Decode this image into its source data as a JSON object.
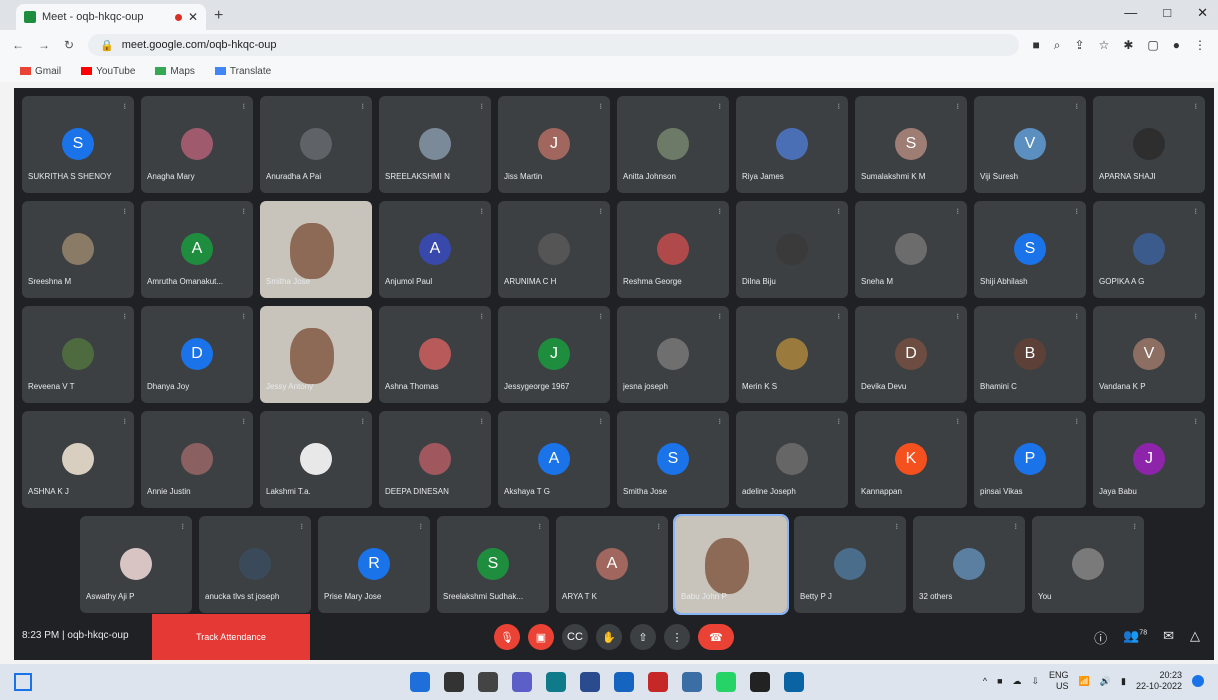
{
  "browser": {
    "tab_title": "Meet - oqb-hkqc-oup",
    "new_tab": "+",
    "url": "meet.google.com/oqb-hkqc-oup",
    "window_controls": [
      "—",
      "□",
      "✕"
    ]
  },
  "bookmarks": [
    {
      "label": "Gmail",
      "color": "#ea4335"
    },
    {
      "label": "YouTube",
      "color": "#ff0000"
    },
    {
      "label": "Maps",
      "color": "#34a853"
    },
    {
      "label": "Translate",
      "color": "#4285f4"
    }
  ],
  "participants": [
    [
      {
        "name": "SUKRITHA S SHENOY",
        "initial": "S",
        "color": "#1a73e8"
      },
      {
        "name": "Anagha Mary",
        "initial": "",
        "color": "#a05a6e"
      },
      {
        "name": "Anuradha A Pai",
        "initial": "",
        "color": "#5f6368"
      },
      {
        "name": "SREELAKSHMI N",
        "initial": "",
        "color": "#7b8a99"
      },
      {
        "name": "Jiss Martin",
        "initial": "J",
        "color": "#a1665e"
      },
      {
        "name": "Anitta Johnson",
        "initial": "",
        "color": "#6d7a68"
      },
      {
        "name": "Riya James",
        "initial": "",
        "color": "#4a6fb5"
      },
      {
        "name": "Sumalakshmi K M",
        "initial": "S",
        "color": "#9e7d74"
      },
      {
        "name": "Viji Suresh",
        "initial": "V",
        "color": "#5a8fc0"
      },
      {
        "name": "APARNA SHAJI",
        "initial": "",
        "color": "#2e2e2e"
      }
    ],
    [
      {
        "name": "Sreeshna M",
        "initial": "",
        "color": "#8a7b66"
      },
      {
        "name": "Amrutha Omanakut...",
        "initial": "A",
        "color": "#1e8e3e"
      },
      {
        "name": "Smitha Jose",
        "initial": "",
        "color": "#c7a08a",
        "video": true
      },
      {
        "name": "Anjumol Paul",
        "initial": "A",
        "color": "#3949ab"
      },
      {
        "name": "ARUNIMA C H",
        "initial": "",
        "color": "#555"
      },
      {
        "name": "Reshma George",
        "initial": "",
        "color": "#b04a4a"
      },
      {
        "name": "Dilna Biju",
        "initial": "",
        "color": "#3a3a3a"
      },
      {
        "name": "Sneha M",
        "initial": "",
        "color": "#6c6c6c"
      },
      {
        "name": "Shiji Abhilash",
        "initial": "S",
        "color": "#1a73e8"
      },
      {
        "name": "GOPIKA A G",
        "initial": "",
        "color": "#3b5b8c"
      }
    ],
    [
      {
        "name": "Reveena V T",
        "initial": "",
        "color": "#4d6b3f"
      },
      {
        "name": "Dhanya Joy",
        "initial": "D",
        "color": "#1a73e8"
      },
      {
        "name": "Jessy Antony",
        "initial": "",
        "color": "#c9c4bb",
        "video": true
      },
      {
        "name": "Ashna Thomas",
        "initial": "",
        "color": "#b85a5a"
      },
      {
        "name": "Jessygeorge 1967",
        "initial": "J",
        "color": "#1e8e3e"
      },
      {
        "name": "jesna joseph",
        "initial": "",
        "color": "#6f6f6f"
      },
      {
        "name": "Merin K S",
        "initial": "",
        "color": "#9a7b3d"
      },
      {
        "name": "Devika Devu",
        "initial": "D",
        "color": "#6d4c41"
      },
      {
        "name": "Bhamini C",
        "initial": "B",
        "color": "#5d4037"
      },
      {
        "name": "Vandana K P",
        "initial": "V",
        "color": "#8d6e63"
      }
    ],
    [
      {
        "name": "ASHNA K J",
        "initial": "",
        "color": "#d8cfc0"
      },
      {
        "name": "Annie Justin",
        "initial": "",
        "color": "#8a6060"
      },
      {
        "name": "Lakshmi T.a.",
        "initial": "",
        "color": "#e8e8e8"
      },
      {
        "name": "DEEPA DINESAN",
        "initial": "",
        "color": "#a0585e"
      },
      {
        "name": "Akshaya T G",
        "initial": "A",
        "color": "#1a73e8"
      },
      {
        "name": "Smitha Jose",
        "initial": "S",
        "color": "#1a73e8"
      },
      {
        "name": "adeline Joseph",
        "initial": "",
        "color": "#666"
      },
      {
        "name": "Kannappan",
        "initial": "K",
        "color": "#f4511e"
      },
      {
        "name": "pinsai Vikas",
        "initial": "P",
        "color": "#1a73e8"
      },
      {
        "name": "Jaya Babu",
        "initial": "J",
        "color": "#8e24aa"
      }
    ],
    [
      {
        "name": "Aswathy Aji P",
        "initial": "",
        "color": "#d9c4c4"
      },
      {
        "name": "anucka tlvs st joseph",
        "initial": "",
        "color": "#3b4a5a"
      },
      {
        "name": "Prise Mary Jose",
        "initial": "R",
        "color": "#1a73e8"
      },
      {
        "name": "Sreelakshmi Sudhak...",
        "initial": "S",
        "color": "#1e8e3e"
      },
      {
        "name": "ARYA T K",
        "initial": "A",
        "color": "#a1665e"
      },
      {
        "name": "Babu John P",
        "initial": "",
        "color": "#c9b8a0",
        "video": true,
        "highlight": true
      },
      {
        "name": "Betty P J",
        "initial": "",
        "color": "#4a6d8c"
      },
      {
        "name": "32 others",
        "initial": "",
        "color": "#5a7fa0"
      },
      {
        "name": "You",
        "initial": "",
        "color": "#7a7a7a"
      }
    ]
  ],
  "bottom_bar": {
    "time_and_code": "8:23 PM  |  oqb-hkqc-oup",
    "attendance_button": "Track Attendance",
    "participant_count": "78"
  },
  "taskbar": {
    "lang": "ENG",
    "region": "US",
    "time": "20:23",
    "date": "22-10-2022"
  }
}
